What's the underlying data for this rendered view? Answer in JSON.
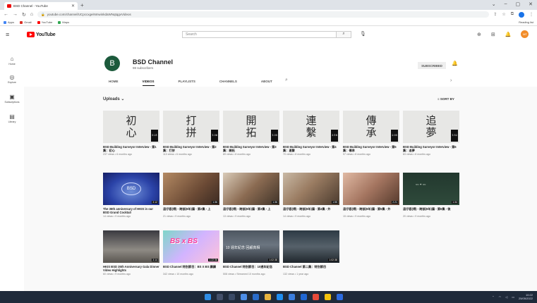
{
  "browser": {
    "tab_title": "BSD Channel - YouTube",
    "url": "youtube.com/channel/UCpccxgeiNmwinkdaWNqtqgvVideos",
    "bookmarks": [
      "Apps",
      "Gmail",
      "YouTube",
      "Maps"
    ],
    "bookmarks_right": "Reading list"
  },
  "youtube": {
    "logo_text": "YouTube",
    "search_placeholder": "Search",
    "avatar_initials": "MT",
    "sidebar": [
      {
        "label": "Home"
      },
      {
        "label": "Explore"
      },
      {
        "label": "Subscriptions"
      },
      {
        "label": "Library"
      }
    ]
  },
  "channel": {
    "avatar_letter": "B",
    "name": "BSD Channel",
    "subscribers": "98 subscribers",
    "subscribe_label": "SUBSCRIBED",
    "tabs": [
      "HOME",
      "VIDEOS",
      "PLAYLISTS",
      "CHANNELS",
      "ABOUT"
    ],
    "uploads_label": "Uploads",
    "sort_label": "SORT BY"
  },
  "videos_row1": [
    {
      "chars": [
        "初",
        "心"
      ],
      "duration": "5:21",
      "title": "BSD Building Surveyor Interview - 第1集：初心",
      "meta": "237 views • 6 months ago"
    },
    {
      "chars": [
        "打",
        "拼"
      ],
      "duration": "1:36",
      "title": "BSD Building Surveyor Interview - 第2集：打拼",
      "meta": "110 views • 6 months ago"
    },
    {
      "chars": [
        "開",
        "拓"
      ],
      "duration": "1:35",
      "title": "BSD Building Surveyor Interview - 第3集：開拓",
      "meta": "89 views • 8 months ago"
    },
    {
      "chars": [
        "連",
        "繫"
      ],
      "duration": "3:18",
      "title": "BSD Building Surveyor Interview - 第4集：連繫",
      "meta": "70 views • 8 months ago"
    },
    {
      "chars": [
        "傳",
        "承"
      ],
      "duration": "2:05",
      "title": "BSD Building Surveyor Interview - 第5集：傳承",
      "meta": "97 views • 8 months ago"
    },
    {
      "chars": [
        "追",
        "夢"
      ],
      "duration": "1:52",
      "title": "BSD Building Surveyor Interview - 第6集：追夢",
      "meta": "83 views • 8 months ago"
    }
  ],
  "videos_row2": [
    {
      "duration": "3:12",
      "title": "The 35th anniversary of HKIS in our BSD Grand Cocktail",
      "meta": "14 views • 9 months ago"
    },
    {
      "duration": "1:36",
      "title": "這仔套(得) - 跨部(8年)篇 - 第2集 - 上",
      "meta": "21 views • 9 months ago"
    },
    {
      "duration": "1:36",
      "title": "這仔套(得) - 跨部(8年)篇 - 第3集 - 上",
      "meta": "13 views • 9 months ago"
    },
    {
      "duration": "1:55",
      "title": "這仔套(得) - 跨部(8年)篇 - 第4集 - 外",
      "meta": "14 views • 9 months ago"
    },
    {
      "duration": "2:21",
      "title": "這仔套(得) - 跨部(8年)篇 - 第5集 - 外",
      "meta": "15 views • 9 months ago"
    },
    {
      "duration": "1:34",
      "title": "這仔套(得) - 跨部(8年)篇 - 第6集 - 後",
      "meta": "20 views • 9 months ago"
    }
  ],
  "videos_row3": [
    {
      "duration": "3:14",
      "title": "HKIS BSD 35th Anniversary Gala Dinner Video Highlights",
      "meta": "60 views • 9 months ago"
    },
    {
      "duration": "1:22:36",
      "title": "BSD Channel 特別節目：BS X BS 講講",
      "meta": "342 views • 10 months ago",
      "label": "BS x BS"
    },
    {
      "duration": "1:02:38",
      "title": "BSD Channel 特別節目：10週年紀念",
      "meta": "508 views • Streamed 10 months ago",
      "label": "10 週年紀念 回顧真相"
    },
    {
      "duration": "1:02:38",
      "title": "BSD Channel 第二集：特別節目",
      "meta": "132 views • 1 year ago"
    }
  ],
  "taskbar": {
    "time": "10:22",
    "date": "25/05/2022"
  }
}
